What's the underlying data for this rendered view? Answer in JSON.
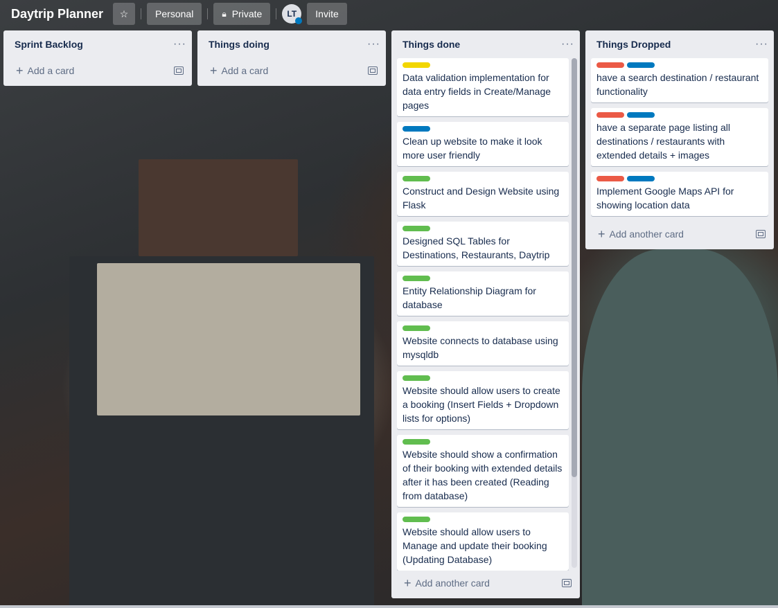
{
  "board": {
    "title": "Daytrip Planner",
    "visibility_personal": "Personal",
    "visibility_private": "Private",
    "member_initials": "LT",
    "invite_label": "Invite"
  },
  "label_colors": {
    "yellow": "#f2d600",
    "blue": "#0079bf",
    "green": "#61bd4f",
    "red": "#eb5a46"
  },
  "lists": [
    {
      "title": "Sprint Backlog",
      "menu": "···",
      "add_label": "Add a card",
      "cards": []
    },
    {
      "title": "Things doing",
      "menu": "···",
      "add_label": "Add a card",
      "cards": []
    },
    {
      "title": "Things done",
      "menu": "···",
      "add_label": "Add another card",
      "cards": [
        {
          "labels": [
            "yellow"
          ],
          "text": "Data validation implementation for data entry fields in Create/Manage pages"
        },
        {
          "labels": [
            "blue"
          ],
          "text": "Clean up website to make it look more user friendly"
        },
        {
          "labels": [
            "green"
          ],
          "text": "Construct and Design Website using Flask"
        },
        {
          "labels": [
            "green"
          ],
          "text": "Designed SQL Tables for Destinations, Restaurants, Daytrip"
        },
        {
          "labels": [
            "green"
          ],
          "text": "Entity Relationship Diagram for database"
        },
        {
          "labels": [
            "green"
          ],
          "text": "Website connects to database using mysqldb"
        },
        {
          "labels": [
            "green"
          ],
          "text": "Website should allow users to create a booking (Insert Fields + Dropdown lists for options)"
        },
        {
          "labels": [
            "green"
          ],
          "text": "Website should show a confirmation of their booking with extended details after it has been created (Reading from database)"
        },
        {
          "labels": [
            "green"
          ],
          "text": "Website should allow users to Manage and update their booking (Updating Database)"
        }
      ]
    },
    {
      "title": "Things Dropped",
      "menu": "···",
      "add_label": "Add another card",
      "cards": [
        {
          "labels": [
            "red",
            "blue"
          ],
          "text": "have a search destination / restaurant functionality"
        },
        {
          "labels": [
            "red",
            "blue"
          ],
          "text": "have a separate page listing all destinations / restaurants with extended details + images"
        },
        {
          "labels": [
            "red",
            "blue"
          ],
          "text": "Implement Google Maps API for showing location data"
        }
      ]
    }
  ]
}
